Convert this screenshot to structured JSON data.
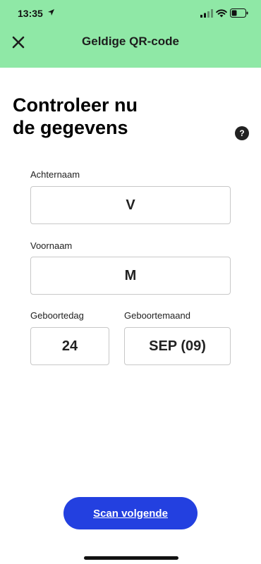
{
  "status_bar": {
    "time": "13:35",
    "icons": [
      "location-arrow-icon",
      "cellular-signal-icon",
      "wifi-icon",
      "battery-icon"
    ]
  },
  "header": {
    "title": "Geldige QR-code",
    "close_icon": "close-icon",
    "background_color": "#8fe8a6"
  },
  "main": {
    "heading_line1": "Controleer nu",
    "heading_line2": "de gegevens",
    "help_icon_glyph": "?",
    "fields": {
      "achternaam": {
        "label": "Achternaam",
        "value": "V"
      },
      "voornaam": {
        "label": "Voornaam",
        "value": "M"
      },
      "geboortedag": {
        "label": "Geboortedag",
        "value": "24"
      },
      "geboortemaand": {
        "label": "Geboortemaand",
        "value": "SEP (09)"
      }
    }
  },
  "footer": {
    "scan_button_label": "Scan volgende",
    "button_color": "#2340e0"
  }
}
